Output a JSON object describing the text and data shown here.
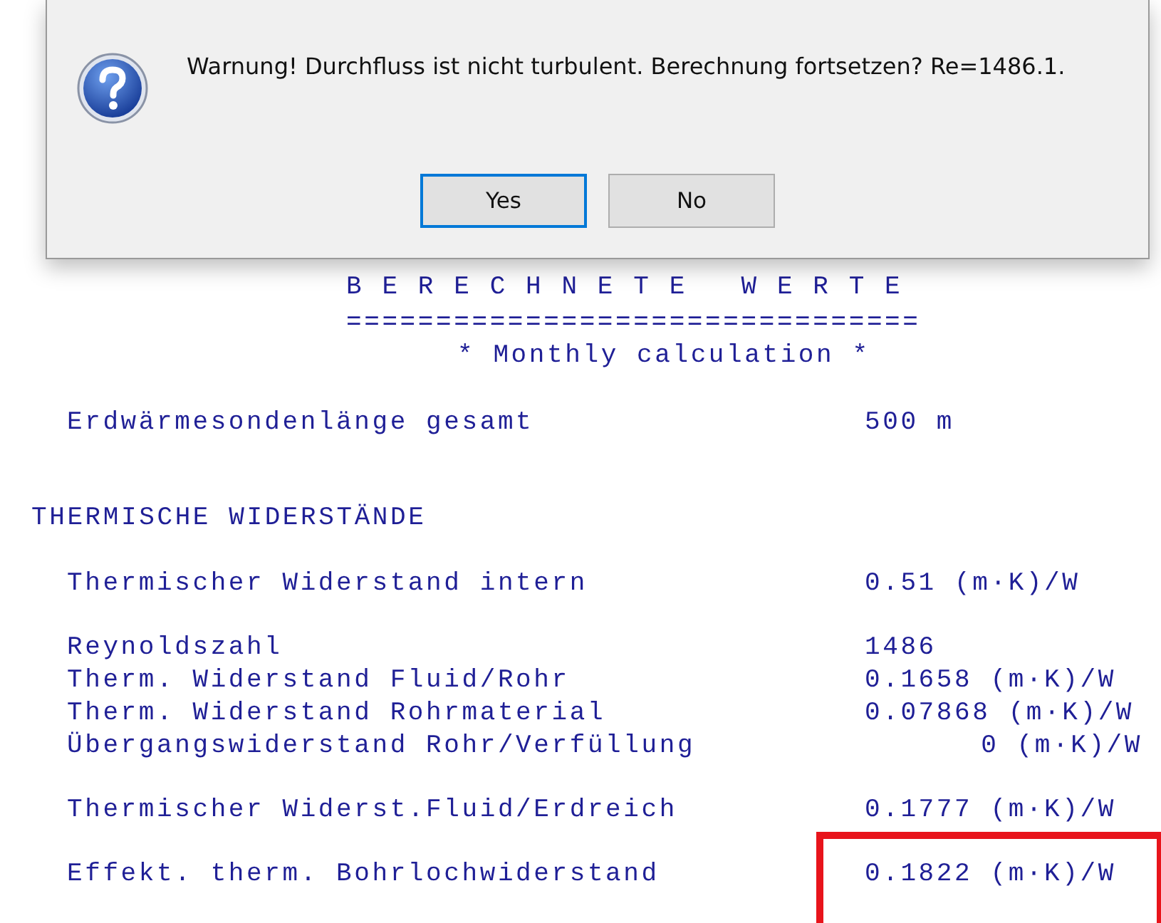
{
  "dialog": {
    "message": "Warnung! Durchfluss ist nicht turbulent. Berechnung fortsetzen? Re=1486.1.",
    "buttons": [
      {
        "label": "Yes",
        "selected": true
      },
      {
        "label": "No",
        "selected": false
      }
    ]
  },
  "report": {
    "title": "B E R E C H N E T E   W E R T E",
    "underline": "================================",
    "subtitle": "* Monthly calculation *",
    "blocks": [
      {
        "kind": "rows",
        "rows": [
          {
            "label": "Erdwärmesondenlänge gesamt",
            "value": "500 m",
            "kind": "plain",
            "highlighted": false
          }
        ]
      },
      {
        "kind": "heading",
        "text": "THERMISCHE WIDERSTÄNDE"
      },
      {
        "kind": "rows",
        "rows": [
          {
            "label": "Thermischer Widerstand intern",
            "value": "0.51 (m·K)/W",
            "kind": "plain",
            "highlighted": false
          }
        ]
      },
      {
        "kind": "rows",
        "rows": [
          {
            "label": "Reynoldszahl",
            "value": "1486",
            "kind": "plain",
            "highlighted": false
          },
          {
            "label": "Therm. Widerstand Fluid/Rohr",
            "value": "0.1658 (m·K)/W",
            "kind": "plain",
            "highlighted": false
          },
          {
            "label": "Therm. Widerstand Rohrmaterial",
            "value": "0.07868 (m·K)/W",
            "kind": "plain",
            "highlighted": false
          },
          {
            "label": "Übergangswiderstand Rohr/Verfüllung",
            "value": "0 (m·K)/W",
            "kind": "padded",
            "highlighted": false
          }
        ]
      },
      {
        "kind": "rows",
        "rows": [
          {
            "label": "Thermischer Widerst.Fluid/Erdreich",
            "value": "0.1777 (m·K)/W",
            "kind": "plain",
            "highlighted": false
          }
        ]
      },
      {
        "kind": "rows",
        "rows": [
          {
            "label": "Effekt. therm. Bohrlochwiderstand",
            "value": "0.1822 (m·K)/W",
            "kind": "plain",
            "highlighted": true
          }
        ]
      }
    ]
  }
}
